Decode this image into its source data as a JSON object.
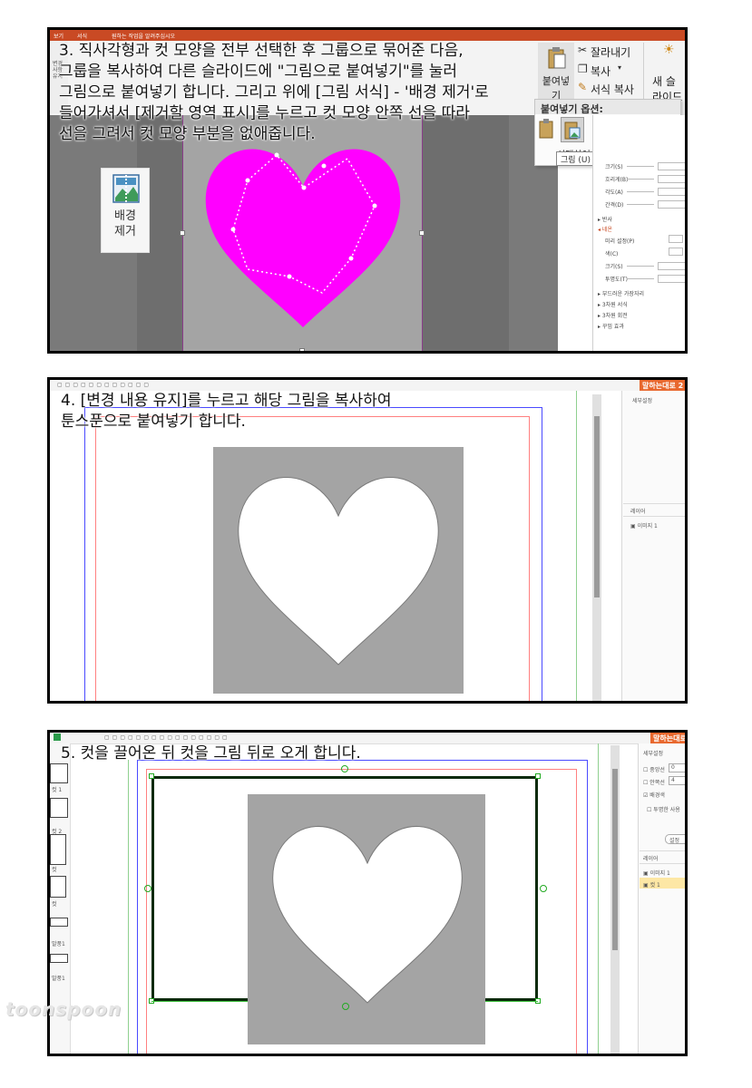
{
  "panel1": {
    "caption": "3. 직사각형과 컷 모양을 전부 선택한 후 그룹으로 묶어준 다음,\n그룹을 복사하여 다른 슬라이드에 \"그림으로 붙여넣기\"를 눌러\n그림으로 붙여넣기 합니다. 그리고 위에 [그림 서식] - '배경 제거'로\n들어가셔서 [제거할 영역 표시]를 누르고 컷 모양 안쪽 선을 따라\n선을 그려서 컷 모양 부분을 없애줍니다.",
    "menu_tabs": [
      "보기",
      "서식"
    ],
    "search_hint": "원하는 작업을 알려주십시오",
    "paste_label": "붙여넣기",
    "cut_label": "잘라내기",
    "copy_label": "복사",
    "format_copy_label": "서식 복사",
    "new_slide_label": "새 슬라이드",
    "paste_options_title": "붙여넣기 옵션:",
    "paste_special_label": "선택하여 붙여넣기(S)...",
    "tooltip_label": "그림 (U)",
    "bg_remove_label": "배경\n제거",
    "left_tool_label": "변경\n사항\n유지",
    "side_rows": [
      "크기(S)",
      "흐리게(B)",
      "각도(A)",
      "간격(D)"
    ],
    "side_section_reflect": "반사",
    "side_section_glow": "네온",
    "glow_rows": [
      "미리 설정(P)",
      "색(C)",
      "크기(S)",
      "투명도(T)"
    ],
    "side_sections_bottom": [
      "부드러운 가장자리",
      "3차원 서식",
      "3차원 회전",
      "꾸밈 효과"
    ]
  },
  "panel2": {
    "caption": "4. [변경 내용 유지]를 누르고 해당 그림을 복사하여\n툰스푼으로 붙여넣기 합니다.",
    "help_button": "말하는대로 2",
    "prop_title": "세부설정",
    "layer_title": "레이어",
    "layers": [
      "이미지 1"
    ]
  },
  "panel3": {
    "caption": "5. 컷을 끌어온 뒤 컷을 그림 뒤로 오게 합니다.",
    "help_button": "말하는대로",
    "prop_title": "세부설정",
    "checkbox_rows": [
      "중앙선",
      "안쪽선",
      "배경색",
      "투명한 사용"
    ],
    "stepper_values": [
      "0",
      "4"
    ],
    "settings_button": "설정",
    "layer_title": "레이어",
    "layers": [
      "이미지 1",
      "컷 1"
    ],
    "thumb_labels": [
      "컷 1",
      "컷 2",
      "컷",
      "컷",
      "말풍1",
      "말풍1"
    ]
  },
  "watermark": "toonspoon",
  "colors": {
    "heart_magenta": "#ff00ff",
    "slide_gray": "#a4a4a4",
    "dark_gray": "#7a7a7a",
    "accent_orange": "#e8682e",
    "cut_frame_green": "#1a8c1a"
  }
}
